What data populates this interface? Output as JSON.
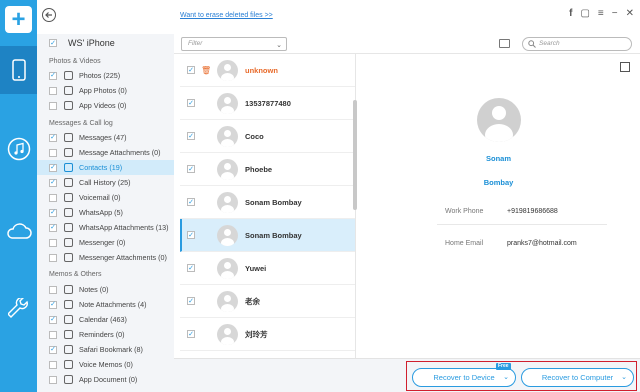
{
  "app": {
    "accent": "#2aa2e3",
    "accent_dark": "#1e83c4",
    "highlight": "#d01f2e"
  },
  "rail": {
    "items": [
      "phone-icon",
      "music-icon",
      "cloud-icon",
      "wrench-icon"
    ]
  },
  "topbar": {
    "erase_link": "Want to erase deleted files >>"
  },
  "sidebar": {
    "device": "WS' iPhone",
    "sections": [
      {
        "title": "Photos & Videos",
        "items": [
          {
            "label": "Photos (225)",
            "checked": true
          },
          {
            "label": "App Photos (0)",
            "checked": false
          },
          {
            "label": "App Videos (0)",
            "checked": false
          }
        ]
      },
      {
        "title": "Messages & Call log",
        "items": [
          {
            "label": "Messages (47)",
            "checked": true
          },
          {
            "label": "Message Attachments (0)",
            "checked": false
          },
          {
            "label": "Contacts (19)",
            "checked": true,
            "active": true
          },
          {
            "label": "Call History (25)",
            "checked": true
          },
          {
            "label": "Voicemail (0)",
            "checked": false
          },
          {
            "label": "WhatsApp (5)",
            "checked": true
          },
          {
            "label": "WhatsApp Attachments (13)",
            "checked": true
          },
          {
            "label": "Messenger (0)",
            "checked": false
          },
          {
            "label": "Messenger Attachments (0)",
            "checked": false
          }
        ]
      },
      {
        "title": "Memos & Others",
        "items": [
          {
            "label": "Notes (0)",
            "checked": false
          },
          {
            "label": "Note Attachments (4)",
            "checked": true
          },
          {
            "label": "Calendar (463)",
            "checked": true
          },
          {
            "label": "Reminders (0)",
            "checked": false
          },
          {
            "label": "Safari Bookmark (8)",
            "checked": true
          },
          {
            "label": "Voice Memos (0)",
            "checked": false
          },
          {
            "label": "App Document (0)",
            "checked": false
          }
        ]
      }
    ]
  },
  "toolbar": {
    "filter_placeholder": "Filter",
    "search_placeholder": "Search"
  },
  "contacts": [
    {
      "name": "unknown",
      "checked": true,
      "deleted": true
    },
    {
      "name": "13537877480",
      "checked": true
    },
    {
      "name": "Coco",
      "checked": true
    },
    {
      "name": "Phoebe",
      "checked": true
    },
    {
      "name": "Sonam Bombay",
      "checked": true
    },
    {
      "name": "Sonam Bombay",
      "checked": true,
      "selected": true
    },
    {
      "name": "Yuwei",
      "checked": true
    },
    {
      "name": "老余",
      "checked": true
    },
    {
      "name": "刘玲芳",
      "checked": true
    }
  ],
  "detail": {
    "first_name": "Sonam",
    "last_name": "Bombay",
    "work_phone_label": "Work Phone",
    "work_phone": "+919819686688",
    "home_email_label": "Home Email",
    "home_email": "pranks7@hotmail.com"
  },
  "actions": {
    "recover_device": "Recover to Device",
    "free_badge": "Free",
    "recover_computer": "Recover to Computer"
  }
}
